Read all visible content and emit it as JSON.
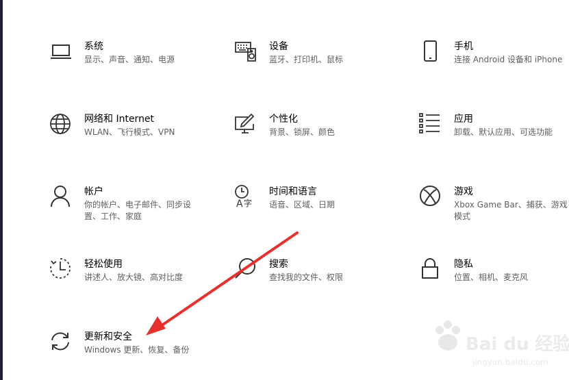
{
  "settings": {
    "items": [
      {
        "title": "系统",
        "desc": "显示、声音、通知、电源",
        "icon": "laptop-icon"
      },
      {
        "title": "设备",
        "desc": "蓝牙、打印机、鼠标",
        "icon": "keyboard-speaker-icon"
      },
      {
        "title": "手机",
        "desc": "连接 Android 设备和 iPhone",
        "icon": "phone-icon"
      },
      {
        "title": "网络和 Internet",
        "desc": "WLAN、飞行模式、VPN",
        "icon": "globe-icon"
      },
      {
        "title": "个性化",
        "desc": "背景、锁屏、颜色",
        "icon": "paint-monitor-icon"
      },
      {
        "title": "应用",
        "desc": "卸载、默认应用、可选功能",
        "icon": "app-list-icon"
      },
      {
        "title": "帐户",
        "desc": "你的帐户、电子邮件、同步设置、工作、家庭",
        "icon": "person-icon"
      },
      {
        "title": "时间和语言",
        "desc": "语音、区域、日期",
        "icon": "time-language-icon"
      },
      {
        "title": "游戏",
        "desc": "Xbox Game Bar、捕获、游戏模式",
        "icon": "xbox-icon"
      },
      {
        "title": "轻松使用",
        "desc": "讲述人、放大镜、高对比度",
        "icon": "ease-of-access-icon"
      },
      {
        "title": "搜索",
        "desc": "查找我的文件、权限",
        "icon": "search-icon"
      },
      {
        "title": "隐私",
        "desc": "位置、相机、麦克风",
        "icon": "lock-icon"
      },
      {
        "title": "更新和安全",
        "desc": "Windows 更新、恢复、备份",
        "icon": "sync-icon"
      }
    ]
  },
  "colors": {
    "arrow": "#e8302c",
    "icon": "#333333",
    "desc": "#5f5f5f"
  },
  "watermark": {
    "brand": "Bai du 经验",
    "url": "jingyan.baidu.com"
  }
}
